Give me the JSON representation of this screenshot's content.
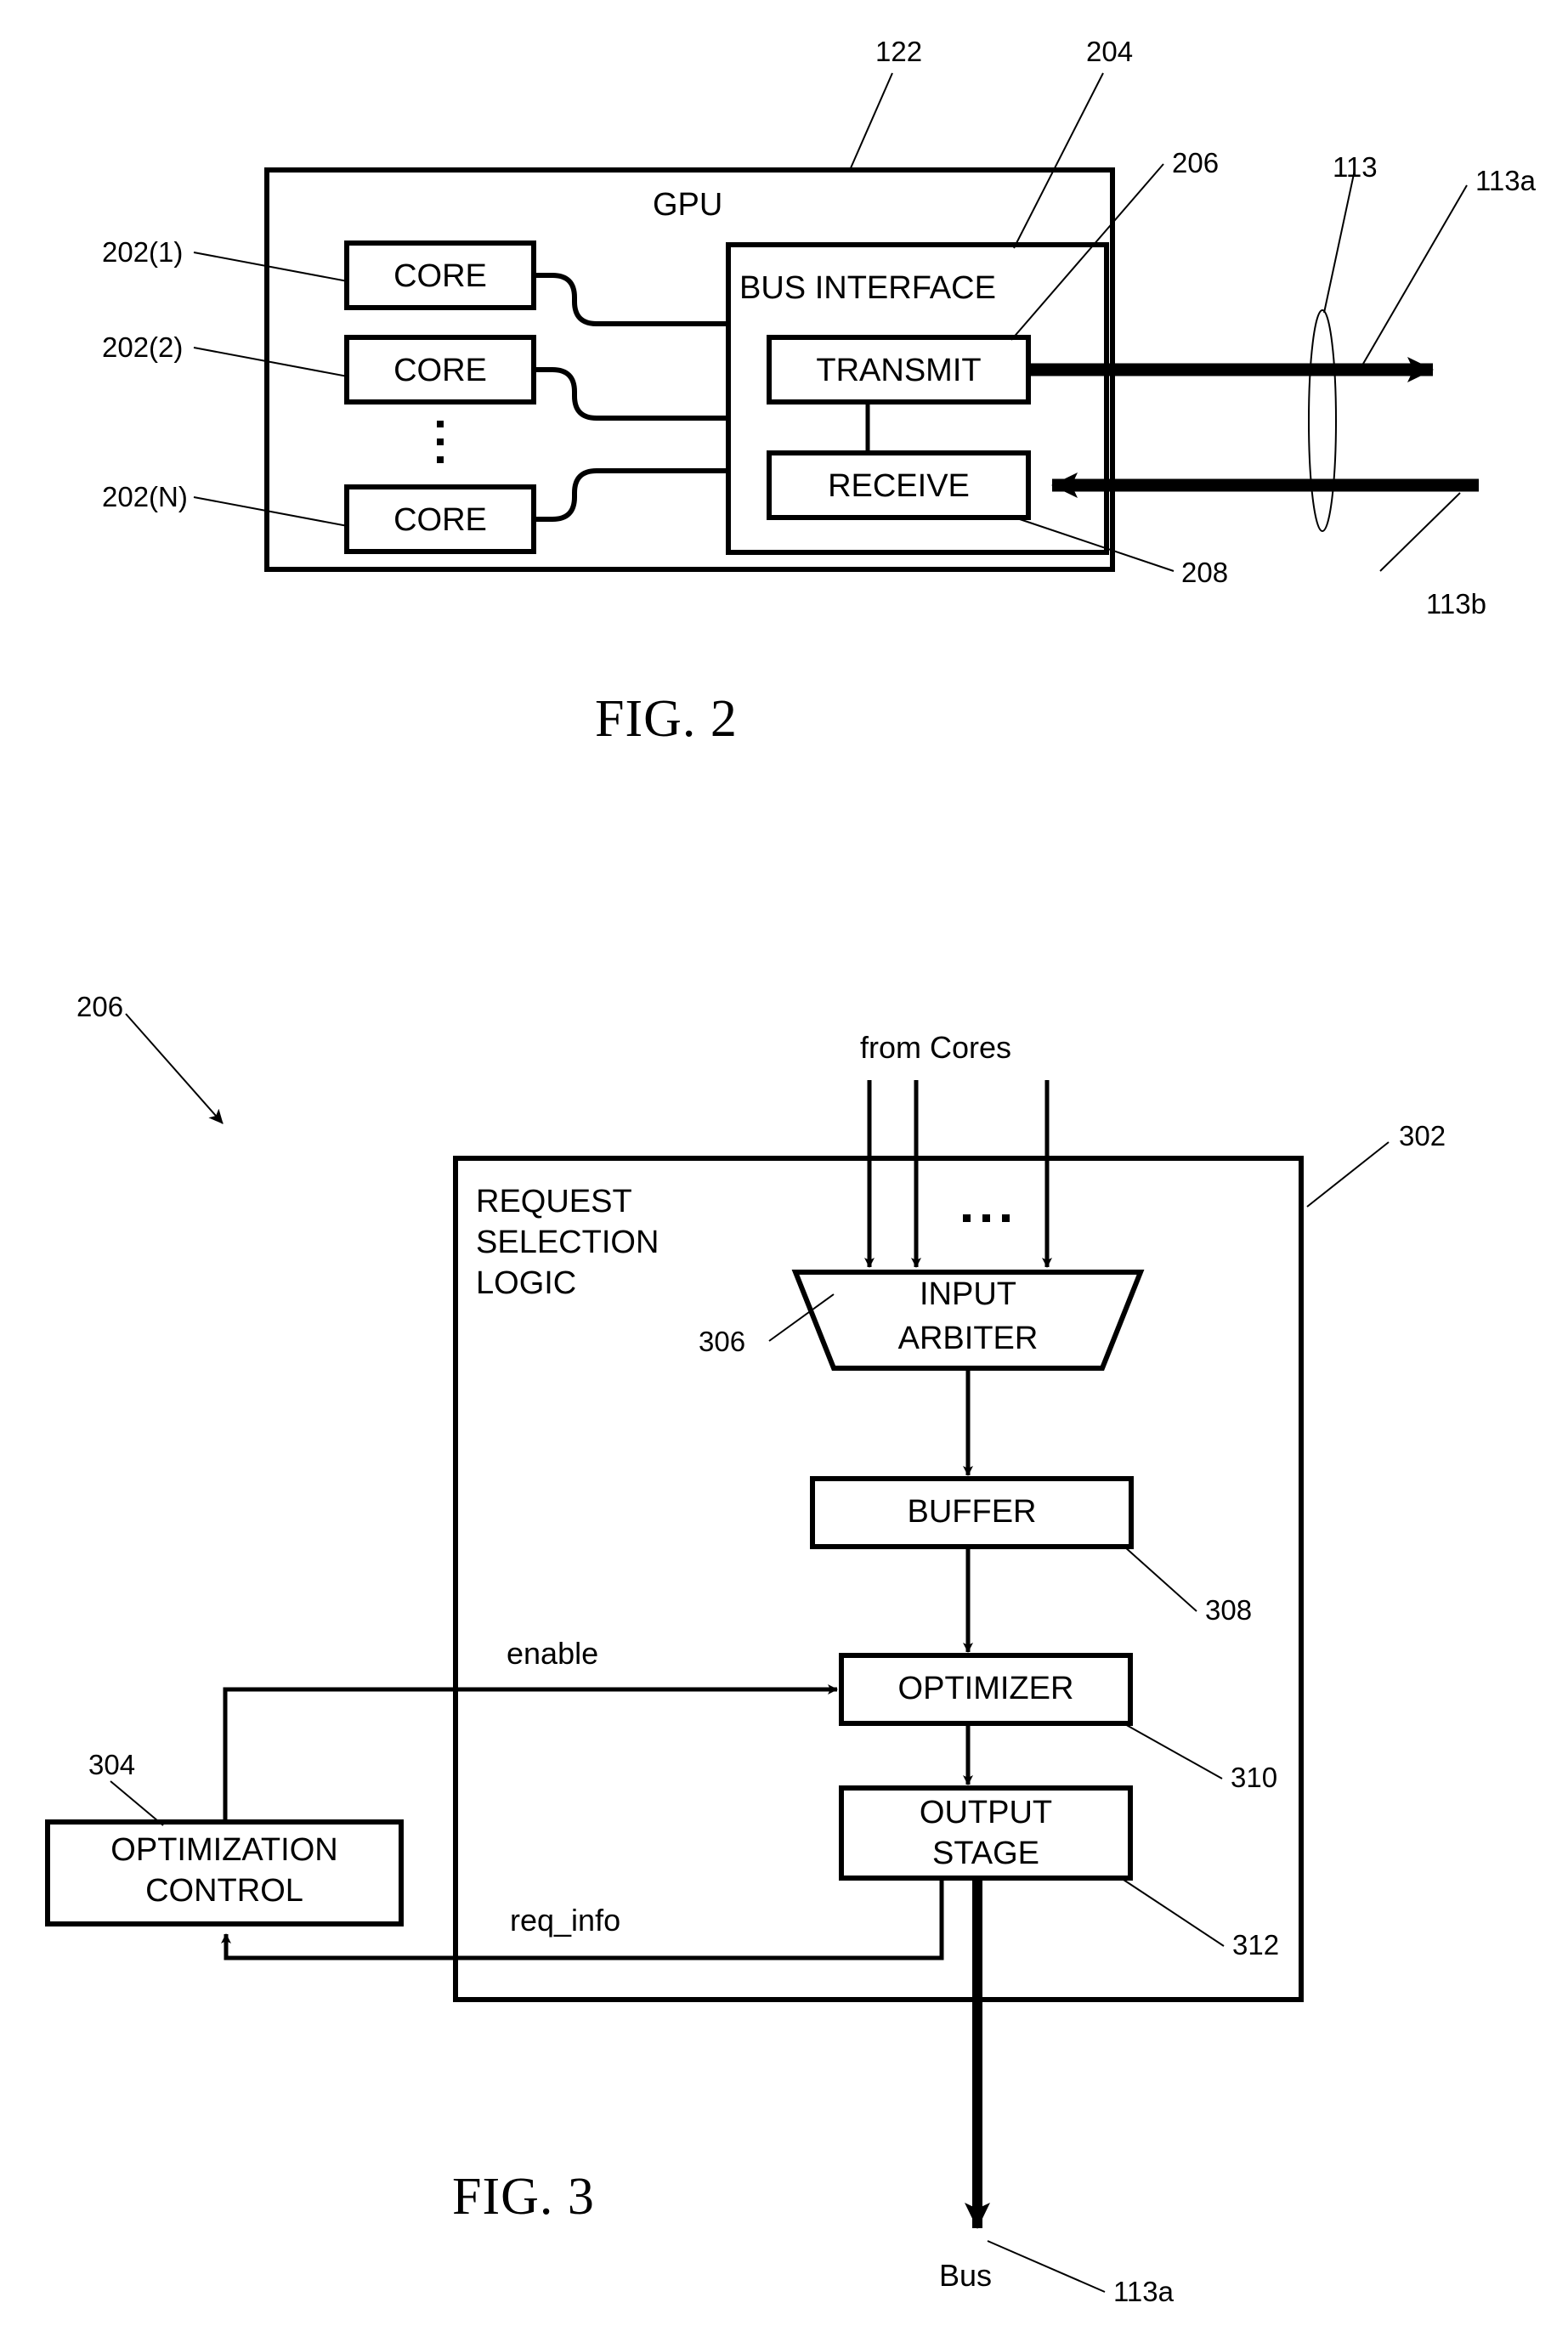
{
  "figures": [
    {
      "caption": "FIG. 2",
      "gpu_label": "GPU",
      "gpu_ref": "122",
      "bus_interface_label": "BUS INTERFACE",
      "bus_interface_ref": "204",
      "transmit_label": "TRANSMIT",
      "transmit_ref": "206",
      "receive_label": "RECEIVE",
      "receive_ref": "208",
      "cores": [
        {
          "label": "CORE",
          "ref": "202(1)"
        },
        {
          "label": "CORE",
          "ref": "202(2)"
        },
        {
          "label": "CORE",
          "ref": "202(N)"
        }
      ],
      "bus_ref": "113",
      "outbound_ref": "113a",
      "inbound_ref": "113b"
    },
    {
      "caption": "FIG. 3",
      "block_ref": "206",
      "outer_ref": "302",
      "request_selection_logic_label": [
        "REQUEST",
        "SELECTION",
        "LOGIC"
      ],
      "from_cores_label": "from Cores",
      "input_arbiter_label": [
        "INPUT",
        "ARBITER"
      ],
      "input_arbiter_ref": "306",
      "buffer_label": "BUFFER",
      "buffer_ref": "308",
      "optimizer_label": "OPTIMIZER",
      "optimizer_ref": "310",
      "output_stage_label": [
        "OUTPUT",
        "STAGE"
      ],
      "output_stage_ref": "312",
      "optimization_control_label": [
        "OPTIMIZATION",
        "CONTROL"
      ],
      "optimization_control_ref": "304",
      "enable_signal": "enable",
      "req_info_signal": "req_info",
      "bus_label": "Bus",
      "bus_ref": "113a"
    }
  ],
  "colors": {
    "ink": "#000000",
    "paper": "#ffffff"
  }
}
